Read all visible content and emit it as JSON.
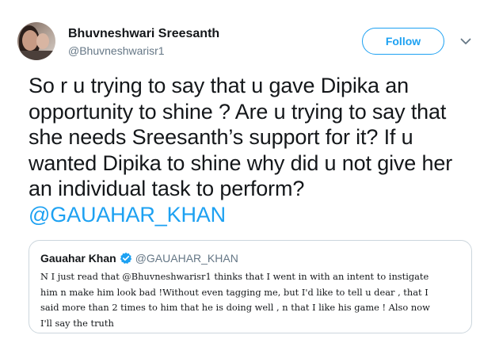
{
  "author": {
    "name": "Bhuvneshwari Sreesanth",
    "handle": "@Bhuvneshwarisr1"
  },
  "actions": {
    "follow_label": "Follow",
    "menu_icon": "chevron-down-icon"
  },
  "tweet": {
    "lines": [
      "So r u trying to say that u gave Dipika an",
      "opportunity to shine ? Are u trying to say that",
      "she needs Sreesanth’s support for it? If u",
      "wanted Dipika to shine why did u not give her",
      "an individual task to perform?"
    ],
    "mention": "@GAUAHAR_KHAN"
  },
  "quoted_tweet": {
    "name": "Gauahar Khan",
    "verified_icon": "verified-badge-icon",
    "handle": "@GAUAHAR_KHAN",
    "lines": [
      "N I just read that @Bhuvneshwarisr1 thinks that I went in with an intent to instigate",
      "him n make him look bad !Without even tagging me, but I'd like to tell u dear , that I",
      "said more than 2 times to him that he is doing well , n that I like his game ! Also now",
      "I'll say the truth"
    ]
  },
  "colors": {
    "accent": "#1da1f2",
    "secondary_text": "#657786",
    "border": "#ccd6dd"
  }
}
